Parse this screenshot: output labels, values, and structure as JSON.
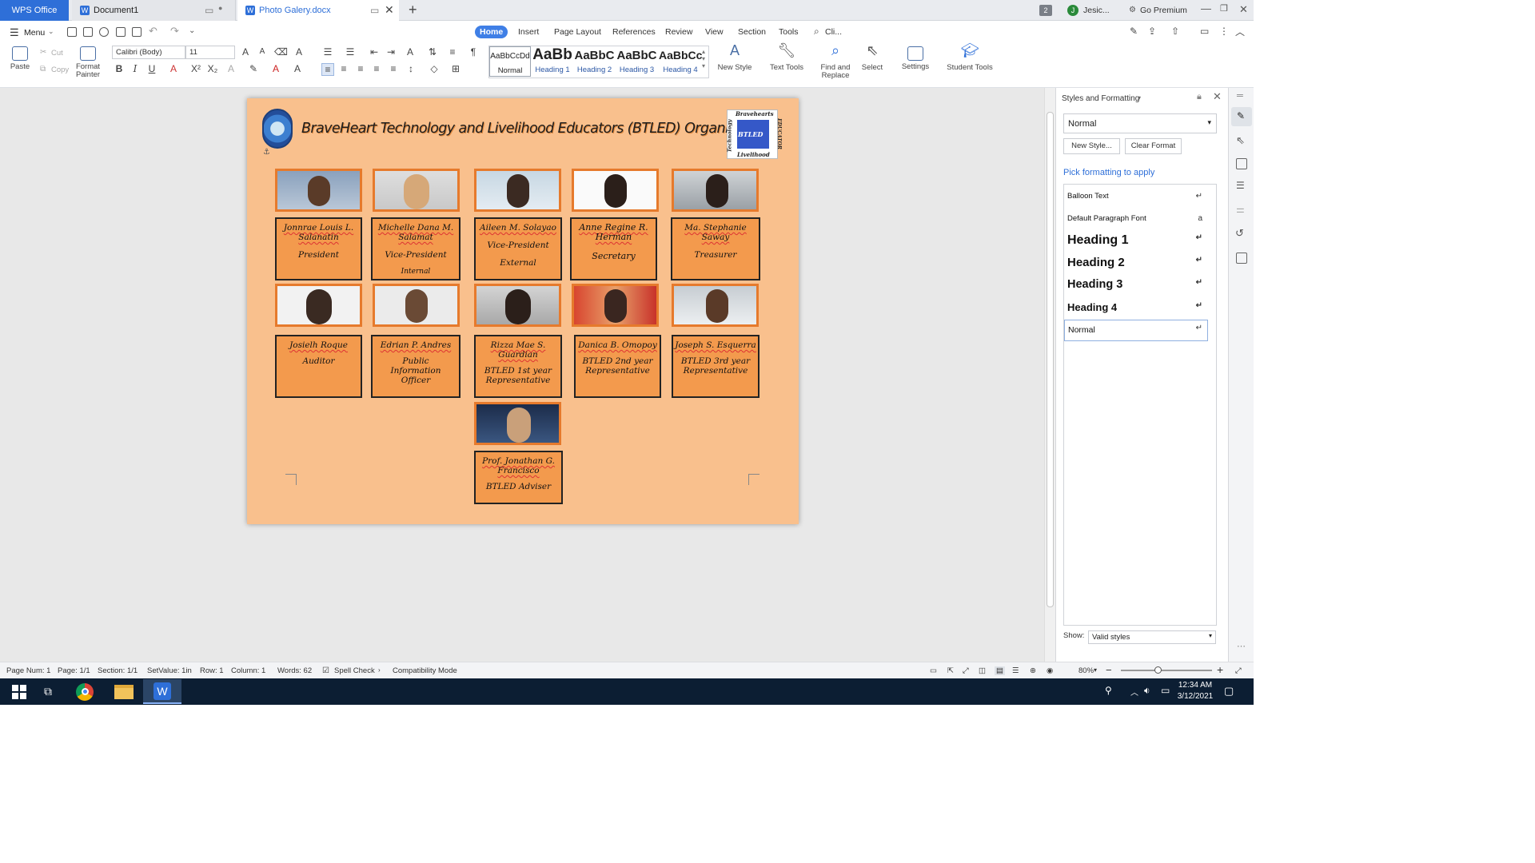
{
  "titlebar": {
    "wps_tab": "WPS Office",
    "doc_tabs": [
      {
        "label": "Document1"
      },
      {
        "label": "Photo Galery.docx"
      }
    ],
    "badge": "2",
    "user": "Jesic...",
    "premium": "Go Premium",
    "user_initial": "J"
  },
  "menu": {
    "menu_label": "Menu",
    "tabs": [
      "Home",
      "Insert",
      "Page Layout",
      "References",
      "Review",
      "View",
      "Section",
      "Tools"
    ],
    "search": "Cli..."
  },
  "ribbon": {
    "paste": "Paste",
    "cut": "Cut",
    "copy": "Copy",
    "format_painter": [
      "Format",
      "Painter"
    ],
    "font_name": "Calibri (Body)",
    "font_size": "11",
    "styles": [
      {
        "sample": "AaBbCcDd",
        "label": "Normal"
      },
      {
        "sample": "AaBb",
        "label": "Heading 1"
      },
      {
        "sample": "AaBbC",
        "label": "Heading 2"
      },
      {
        "sample": "AaBbC",
        "label": "Heading 3"
      },
      {
        "sample": "AaBbCcl",
        "label": "Heading 4"
      }
    ],
    "new_style": "New Style",
    "text_tools": "Text Tools",
    "find_replace": [
      "Find and",
      "Replace"
    ],
    "select": "Select",
    "settings": "Settings",
    "student_tools": "Student Tools"
  },
  "document": {
    "title": "BraveHeart Technology and Livelihood Educators (BTLED) Organization",
    "logo_right": {
      "top": "Bravehearts",
      "left": "Technology",
      "right": "EDUCATOR",
      "center": "BTLED",
      "bottom": "Livelihood"
    },
    "row1": [
      {
        "name": "Jonnrae Louis L. Salanatin",
        "role": "President",
        "role2": ""
      },
      {
        "name": "Michelle Dana M. Salamat",
        "role": "Vice-President",
        "role2": "Internal"
      },
      {
        "name": "Aileen M. Solayao",
        "role": "Vice-President",
        "role2": "External"
      },
      {
        "name": "Anne Regine R. Herman",
        "role": "Secretary",
        "role2": ""
      },
      {
        "name": "Ma. Stephanie Saway",
        "role": "Treasurer",
        "role2": ""
      }
    ],
    "row2": [
      {
        "name": "Josielh Roque",
        "role": "Auditor"
      },
      {
        "name": "Edrian P. Andres",
        "role": "Public Information Officer"
      },
      {
        "name": "Rizza Mae S. Guardian",
        "role": "BTLED 1st year Representative"
      },
      {
        "name": "Danica B. Omopoy",
        "role": "BTLED 2nd year Representative"
      },
      {
        "name": "Joseph S. Esquerra",
        "role": "BTLED 3rd year Representative"
      }
    ],
    "adviser": {
      "name": "Prof. Jonathan G. Francisco",
      "role": "BTLED Adviser"
    }
  },
  "panel": {
    "title": "Styles and Formatting",
    "current_style": "Normal",
    "new_style_btn": "New Style...",
    "clear_format_btn": "Clear Format",
    "pick_label": "Pick formatting to apply",
    "items": [
      "Balloon Text",
      "Default Paragraph Font",
      "Heading 1",
      "Heading 2",
      "Heading 3",
      "Heading 4",
      "Normal"
    ],
    "show_label": "Show:",
    "show_value": "Valid styles"
  },
  "status": {
    "page_num": "Page Num: 1",
    "page": "Page: 1/1",
    "section": "Section: 1/1",
    "setvalue": "SetValue: 1in",
    "row": "Row: 1",
    "column": "Column: 1",
    "words": "Words: 62",
    "spell": "Spell Check",
    "compat": "Compatibility Mode",
    "zoom": "80%",
    "zoom_level": 0.4
  },
  "taskbar": {
    "time": "12:34 AM",
    "date": "3/12/2021"
  },
  "colors": {
    "accent": "#3f7fe6",
    "page_bg": "#f9c08d",
    "card_bg": "#f39a4d",
    "photo_border": "#e67a2c",
    "taskbar": "#0c1e33"
  }
}
